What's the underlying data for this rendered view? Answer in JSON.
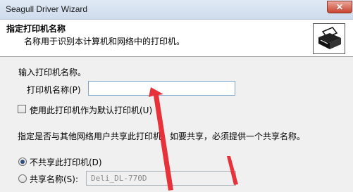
{
  "window": {
    "title": "Seagull Driver Wizard",
    "close_glyph": "✕"
  },
  "header": {
    "title": "指定打印机名称",
    "subtitle": "名称用于识别本计算机和网络中的打印机。",
    "icon": "printer-icon"
  },
  "form": {
    "prompt": "输入打印机名称。",
    "printer_name_label": "打印机名称(P)",
    "printer_name_value": "",
    "default_checkbox_label": "使用此打印机作为默认打印机(U)",
    "default_checked": false,
    "share_prompt": "指定是否与其他网络用户共享此打印机，如要共享，必须提供一个共享名称。",
    "no_share_label": "不共享此打印机(D)",
    "no_share_selected": true,
    "share_label": "共享名称(S):",
    "share_name_value": "Deli_DL-770D"
  },
  "colors": {
    "annotation_arrow": "#e8323a",
    "header_bg": "#ffffff",
    "dialog_bg": "#f0f0f0"
  }
}
